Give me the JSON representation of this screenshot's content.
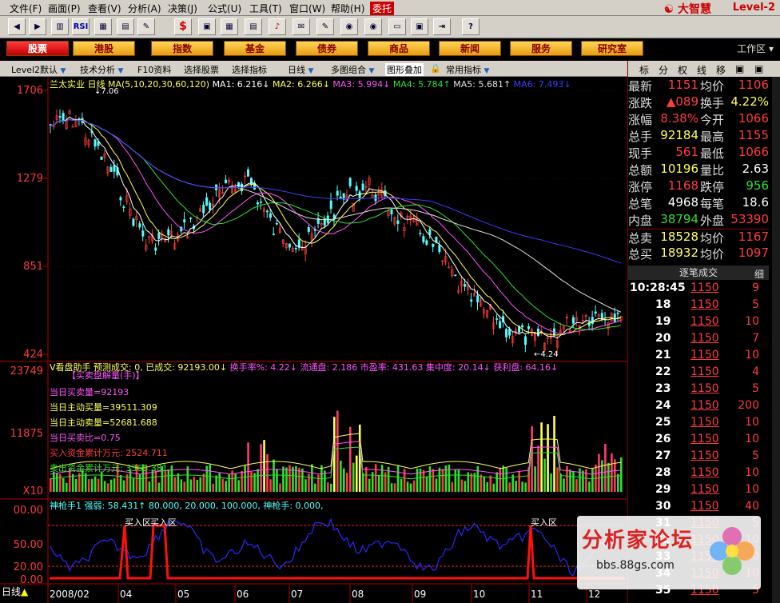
{
  "menu": {
    "items": [
      "文件(F)",
      "画面(P)",
      "查看(V)",
      "分析(A)",
      "决策(J)",
      "公式(U)",
      "工具(T)",
      "窗口(W)",
      "帮助(H)",
      "委托"
    ],
    "brand": "大智慧",
    "level": "Level-2"
  },
  "toolbar": {
    "icons": [
      "back-icon",
      "forward-icon",
      "kline-icon",
      "rsi-icon",
      "grid-icon",
      "ruler-icon",
      "dollar-icon",
      "bank-icon",
      "calendar-icon",
      "chart-icon",
      "bell-icon",
      "news-icon",
      "report-icon",
      "info-icon",
      "window-icon",
      "layout-icon",
      "arrow-icon",
      "question-icon"
    ],
    "rsi_label": "RSI",
    "dollar_label": "$"
  },
  "nav": {
    "items": [
      "股票",
      "港股",
      "指数",
      "基金",
      "债券",
      "商品",
      "新闻",
      "服务",
      "研究室"
    ],
    "work_area": "工作区"
  },
  "subbar": {
    "items": [
      "Level2默认",
      "技术分析",
      "F10资料",
      "选择股票",
      "选择指标",
      "日线",
      "多图组合",
      "图形叠加",
      "常用指标"
    ]
  },
  "chart": {
    "title_line": "兰太实业 日线  MA(5,10,20,30,60,120)",
    "ma_labels": [
      "MA1: 6.216↓",
      "MA2: 6.266↓",
      "MA3: 5.994↓",
      "MA4: 5.784↑",
      "MA5: 5.681↑",
      "MA6: 7.493↓"
    ],
    "ma_colors": [
      "#ffffff",
      "#ffff54",
      "#ff54ff",
      "#30e030",
      "#e0e0e0",
      "#3c3cff"
    ],
    "price_ticks": [
      "1706",
      "1279",
      "851",
      "424"
    ],
    "high_label": "7.06",
    "low_label": "4.24",
    "vol_title": "V看盘助手  预测成交: 0, 已成交: 92193.00↓",
    "vol_stats": [
      "换手率%: 4.22↓",
      "流通盘: 2.186",
      "市盈率: 431.63",
      "集中度: 20.14↓",
      "获利盘: 64.16↓"
    ],
    "vol_panel_title": "【买卖盘解量(手)】",
    "vol_lines": [
      "当日买卖量=92193",
      "当日主动买量=39511.309",
      "当日主动卖量=52681.688",
      "当日买卖比=0.75",
      "买入资金累计万元: 2524.711",
      "卖出资金累计万元: 3366.381"
    ],
    "vol_line_colors": [
      "#ff54ff",
      "#ffff54",
      "#ffff54",
      "#ff54ff",
      "#ff3c3c",
      "#30e030"
    ],
    "vol_ticks": [
      "23749",
      "11875",
      "X10"
    ],
    "ind_title": "神枪手1  强弱: 58.431↑  80.000, 20.000, 100.000, 神枪手: 0.000,",
    "ind_ticks": [
      "00.00",
      "50.00",
      "20.00",
      "0.00"
    ],
    "ind_label": "买入区",
    "date_labels": [
      "2008/02",
      "04",
      "05",
      "06",
      "07",
      "08",
      "09",
      "10",
      "11",
      "12"
    ],
    "bottom_left": "日线"
  },
  "quote": {
    "tabs": [
      "标",
      "分",
      "权",
      "线",
      "移"
    ],
    "rows": [
      {
        "l1": "最新",
        "v1": "1151",
        "c1": "red",
        "l2": "均价",
        "v2": "1106",
        "c2": "red"
      },
      {
        "l1": "涨跌",
        "v1": "▲089",
        "c1": "red",
        "l2": "换手",
        "v2": "4.22%",
        "c2": "yel"
      },
      {
        "l1": "涨幅",
        "v1": "8.38%",
        "c1": "red",
        "l2": "今开",
        "v2": "1066",
        "c2": "red"
      },
      {
        "l1": "总手",
        "v1": "92184",
        "c1": "yel",
        "l2": "最高",
        "v2": "1155",
        "c2": "red"
      },
      {
        "l1": "现手",
        "v1": "561",
        "c1": "red",
        "l2": "最低",
        "v2": "1066",
        "c2": "red"
      },
      {
        "l1": "总额",
        "v1": "10196",
        "c1": "yel",
        "l2": "量比",
        "v2": "2.63",
        "c2": "wht"
      },
      {
        "l1": "涨停",
        "v1": "1168",
        "c1": "red",
        "l2": "跌停",
        "v2": "956",
        "c2": "grn"
      },
      {
        "l1": "总笔",
        "v1": "4968",
        "c1": "wht",
        "l2": "每笔",
        "v2": "18.6",
        "c2": "wht"
      },
      {
        "l1": "内盘",
        "v1": "38794",
        "c1": "grn",
        "l2": "外盘",
        "v2": "53390",
        "c2": "red"
      },
      {
        "l1": "总卖",
        "v1": "18528",
        "c1": "yel",
        "l2": "均价",
        "v2": "1167",
        "c2": "red"
      },
      {
        "l1": "总买",
        "v1": "18932",
        "c1": "yel",
        "l2": "均价",
        "v2": "1097",
        "c2": "red"
      }
    ],
    "tick_header": "逐笔成交",
    "tick_detail": "细",
    "ticks": [
      {
        "t": "10:28:45",
        "p": "1150",
        "v": "9"
      },
      {
        "t": "18",
        "p": "1150",
        "v": "5"
      },
      {
        "t": "19",
        "p": "1150",
        "v": "10"
      },
      {
        "t": "20",
        "p": "1150",
        "v": "7"
      },
      {
        "t": "21",
        "p": "1150",
        "v": "10"
      },
      {
        "t": "22",
        "p": "1150",
        "v": "4"
      },
      {
        "t": "23",
        "p": "1150",
        "v": "5"
      },
      {
        "t": "24",
        "p": "1150",
        "v": "200"
      },
      {
        "t": "25",
        "p": "1150",
        "v": "10"
      },
      {
        "t": "26",
        "p": "1150",
        "v": "10"
      },
      {
        "t": "27",
        "p": "1150",
        "v": "5"
      },
      {
        "t": "28",
        "p": "1150",
        "v": "10"
      },
      {
        "t": "29",
        "p": "1150",
        "v": "10"
      },
      {
        "t": "30",
        "p": "1150",
        "v": "40"
      },
      {
        "t": "31",
        "p": "1150",
        "v": "5"
      },
      {
        "t": "32",
        "p": "1150",
        "v": "10"
      },
      {
        "t": "33",
        "p": "1150",
        "v": "20"
      },
      {
        "t": "34",
        "p": "1150",
        "v": "10"
      },
      {
        "t": "35",
        "p": "1150",
        "v": "5"
      }
    ]
  },
  "watermark": {
    "title": "分析家论坛",
    "url": "bbs.88gs.com"
  }
}
